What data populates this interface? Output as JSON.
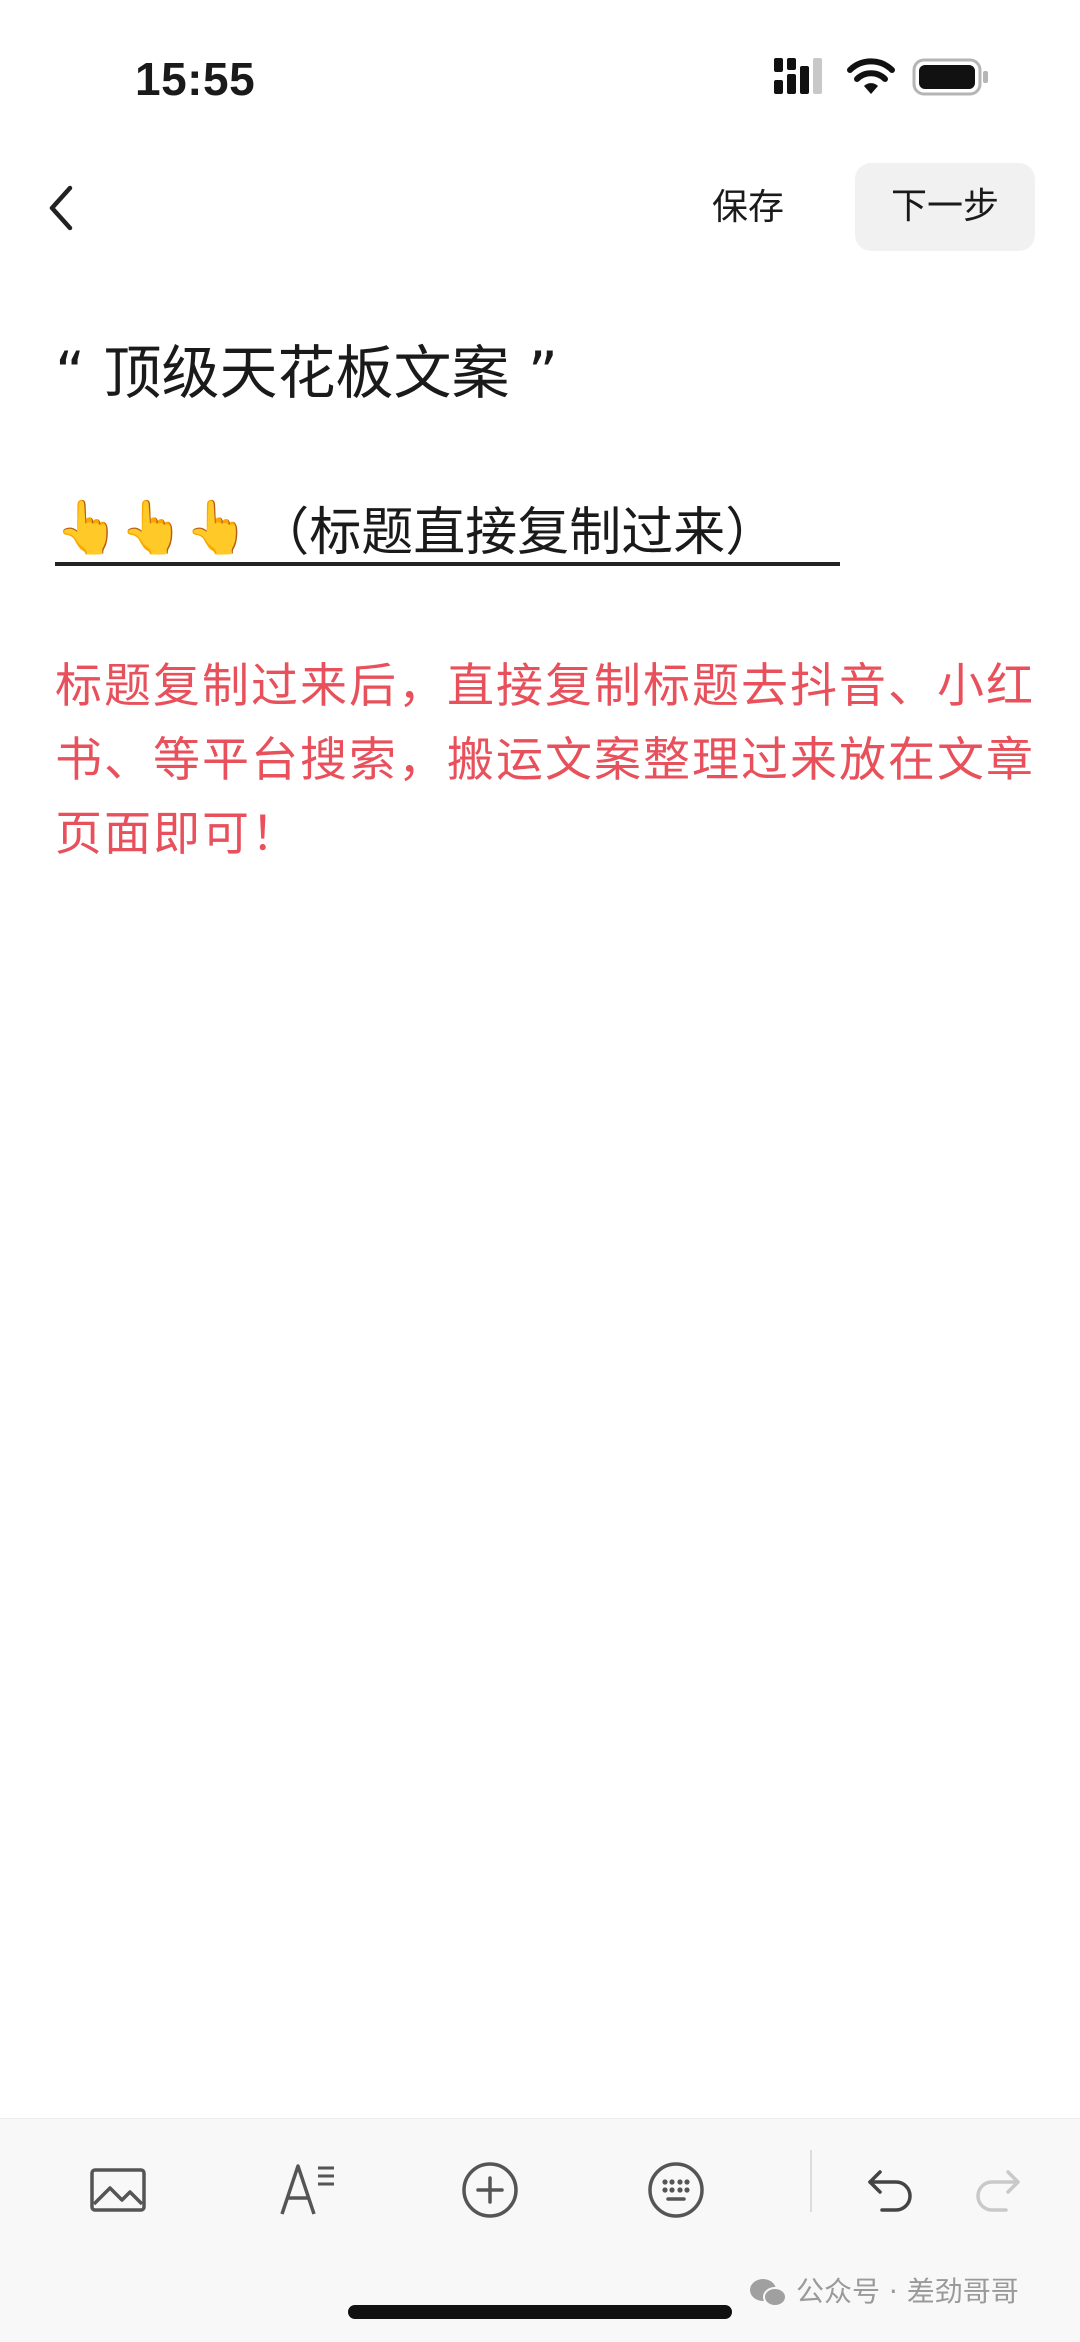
{
  "status_bar": {
    "time": "15:55"
  },
  "nav": {
    "save_label": "保存",
    "next_label": "下一步"
  },
  "content": {
    "title": "“ 顶级天花板文案 ”",
    "subtitle_emoji": "👆👆👆",
    "subtitle": "（标题直接复制过来）",
    "body": "标题复制过来后，直接复制标题去抖音、小红书、等平台搜索，搬运文案整理过来放在文章页面即可！"
  },
  "toolbar": {
    "icons": [
      "image-icon",
      "text-format-icon",
      "add-icon",
      "keyboard-icon",
      "undo-icon",
      "redo-icon"
    ]
  },
  "watermark": {
    "text": "公众号 · 差劲哥哥"
  },
  "colors": {
    "body_text": "#e8505b",
    "next_button_bg": "#f1f1f1"
  }
}
